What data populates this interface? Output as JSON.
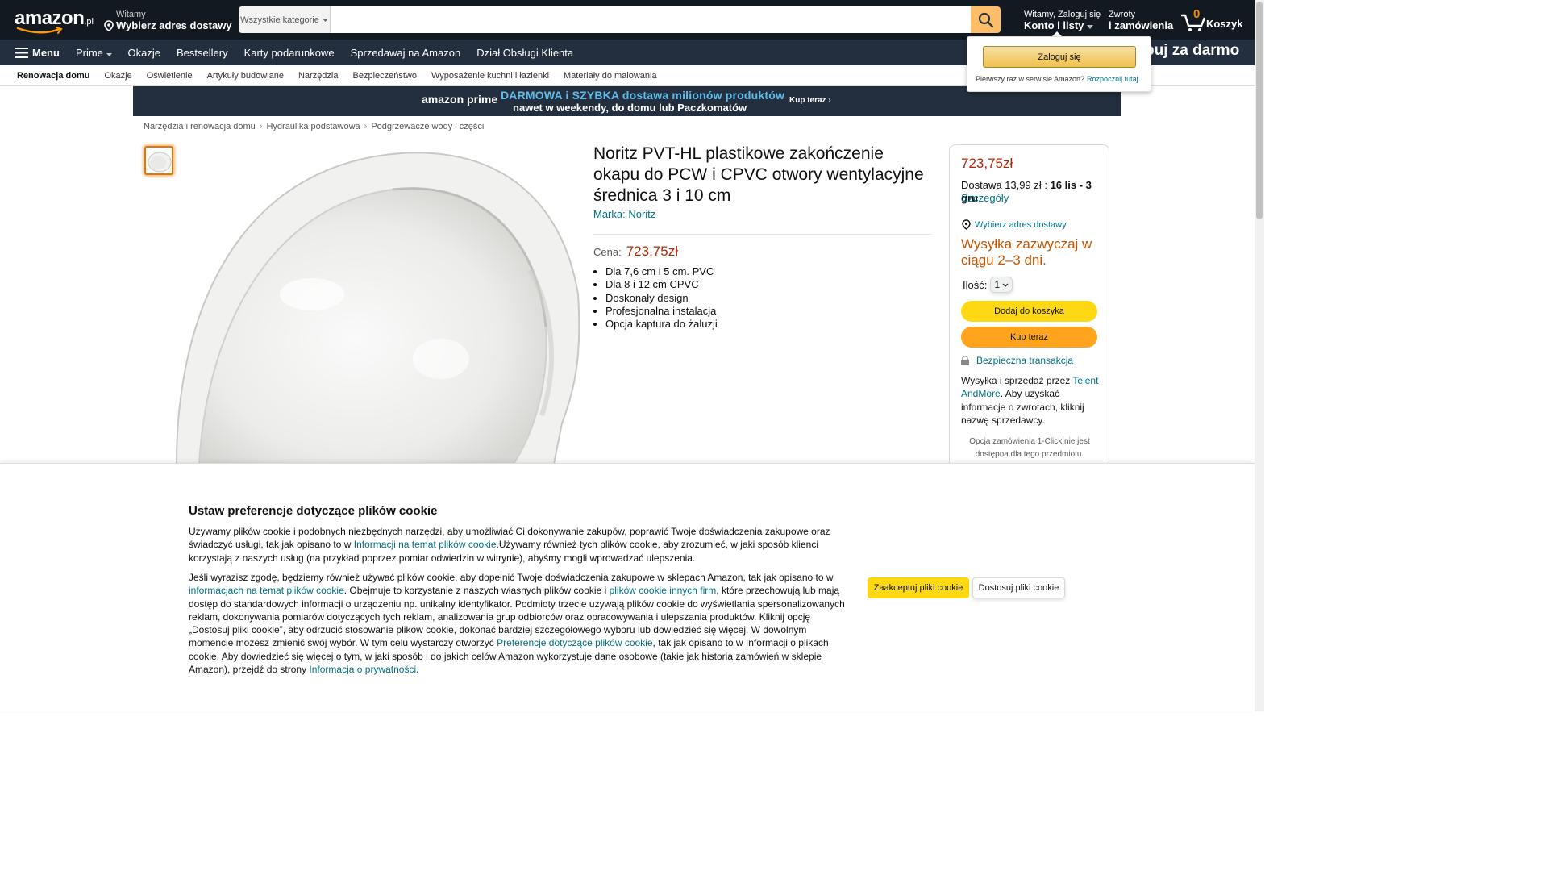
{
  "header": {
    "logo_text": "amazon",
    "logo_tld": ".pl",
    "deliver_line1": "Witamy",
    "deliver_line2": "Wybierz adres dostawy",
    "search_category": "Wszystkie kategorie",
    "search_value": "",
    "account_line1": "Witamy, Zaloguj się",
    "account_line2": "Konto i listy",
    "returns_line1": "Zwroty",
    "returns_line2": "i zamówienia",
    "cart_count": "0",
    "cart_label": "Koszyk"
  },
  "nav_main": {
    "menu_label": "Menu",
    "items": [
      "Prime",
      "Okazje",
      "Bestsellery",
      "Karty podarunkowe",
      "Sprzedawaj na Amazon",
      "Dział Obsługi Klienta"
    ],
    "promo": "buj za darmo"
  },
  "subnav": {
    "items": [
      "Renowacja domu",
      "Okazje",
      "Oświetlenie",
      "Artykuły budowlane",
      "Narzędzia",
      "Bezpieczeństwo",
      "Wyposażenie kuchni i łazienki",
      "Materiały do malowania"
    ]
  },
  "banner": {
    "prime_logo": "amazon prime",
    "line1": "DARMOWA i SZYBKA dostawa milionów produktów",
    "line2": "nawet w weekendy, do domu lub Paczkomatów",
    "cta": "Kup teraz ›"
  },
  "breadcrumb": [
    "Narzędzia i renowacja domu",
    "Hydraulika podstawowa",
    "Podgrzewacze wody i części"
  ],
  "product": {
    "title": "Noritz PVT-HL plastikowe zakończenie okapu do PCW i CPVC otwory wentylacyjne średnica 3 i 10 cm",
    "brand": "Marka: Noritz",
    "price_label": "Cena:",
    "price": "723,75zł",
    "bullets": [
      "Dla 7,6 cm i 5 cm. PVC",
      "Dla 8 i 12 cm CPVC",
      "Doskonały design",
      "Profesjonalna instalacja",
      "Opcja kaptura do żaluzji"
    ]
  },
  "buybox": {
    "price": "723,75zł",
    "delivery_text": "Dostawa 13,99 zł :",
    "delivery_dates": "16 lis - 3 gru",
    "details": "Szczegóły",
    "address": "Wybierz adres dostawy",
    "shipping": "Wysyłka zazwyczaj w ciągu 2–3 dni.",
    "qty_label": "Ilość:",
    "qty_value": "1",
    "add_to_cart": "Dodaj do koszyka",
    "buy_now": "Kup teraz",
    "secure": "Bezpieczna transakcja",
    "sold_prefix": "Wysyłka i sprzedaż przez ",
    "seller": "Telent AndMore",
    "sold_suffix": ". Aby uzyskać informacje o zwrotach, kliknij nazwę sprzedawcy.",
    "oneclick": "Opcja zamówienia 1-Click nie jest dostępna dla tego przedmiotu."
  },
  "flyout": {
    "signin": "Zaloguj się",
    "new_customer": "Pierwszy raz w serwisie Amazon?",
    "start_here": "Rozpocznij tutaj."
  },
  "cookie": {
    "title": "Ustaw preferencje dotyczące plików cookie",
    "p1_a": "Używamy plików cookie i podobnych niezbędnych narzędzi, aby umożliwiać Ci dokonywanie zakupów, poprawić Twoje doświadczenia zakupowe oraz świadczyć usługi, tak jak opisano to w ",
    "p1_link": "Informacji na temat plików cookie",
    "p1_b": ".Używamy również tych plików cookie, aby zrozumieć, w jaki sposób klienci korzystają z naszych usług (na przykład poprzez pomiar odwiedzin w witrynie), abyśmy mogli wprowadzać ulepszenia.",
    "p2_a": "Jeśli wyrazisz zgodę, będziemy również używać plików cookie, aby dopełnić Twoje doświadczenia zakupowe w sklepach Amazon, tak jak opisano to w ",
    "p2_link1": "informacjach na temat plików cookie",
    "p2_b": ". Obejmuje to korzystanie z naszych własnych plików cookie i ",
    "p2_link2": "plików cookie innych firm",
    "p2_c": ", które przechowują lub mają dostęp do standardowych informacji o urządzeniu np. unikalny identyfikator. Podmioty trzecie używają plików cookie do wyświetlania spersonalizowanych reklam, dokonywania pomiarów dotyczących tych reklam, analizowania grup odbiorców oraz opracowywania i ulepszania produktów. Kliknij opcję „Dostosuj pliki cookie”, aby odrzucić stosowanie plików cookie, dokonać bardziej szczegółowego wyboru lub dowiedzieć się więcej. W dowolnym momencie możesz zmienić swój wybór. W tym celu wystarczy otworzyć ",
    "p2_link3": "Preferencje dotyczące plików cookie",
    "p2_d": ", tak jak opisano to w Informacji o plikach cookie. Aby dowiedzieć się więcej o tym, w jaki sposób i do jakich celów Amazon wykorzystuje dane osobowe (takie jak historia zamówień w sklepie Amazon), przejdź do strony ",
    "p2_link4": "Informacja o prywatności",
    "p2_e": ".",
    "accept": "Zaakceptuj pliki cookie",
    "customize": "Dostosuj pliki cookie"
  },
  "colors": {
    "nav_dark": "#131921",
    "nav_secondary": "#232f3e",
    "price_red": "#b12704",
    "link_teal": "#007185",
    "button_yellow": "#ffd814",
    "button_orange": "#ffa41c",
    "shipping_orange": "#c45500",
    "search_button": "#febd69"
  }
}
